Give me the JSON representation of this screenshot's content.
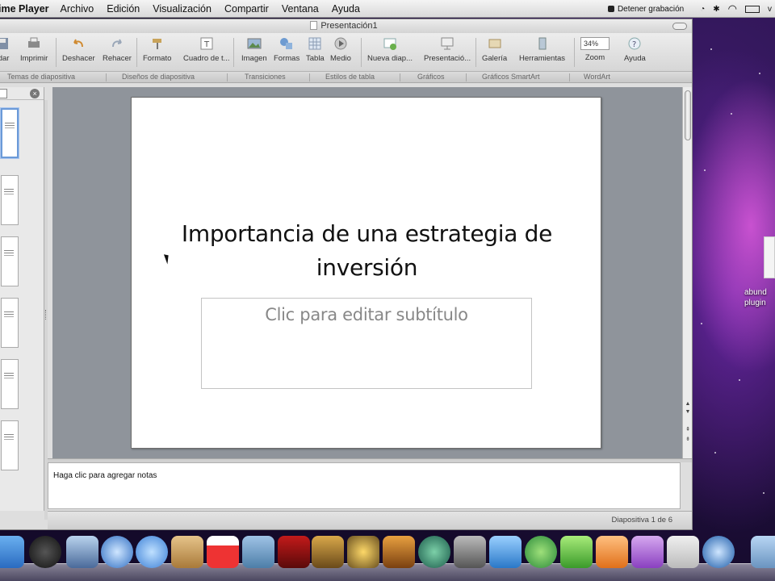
{
  "menubar": {
    "app_name": "ime Player",
    "menus": [
      "Archivo",
      "Edición",
      "Visualización",
      "Compartir",
      "Ventana",
      "Ayuda"
    ],
    "recording_label": "Detener grabación",
    "clock_partial": "v"
  },
  "window": {
    "title": "Presentación1"
  },
  "toolbar": {
    "buttons": [
      "rdar",
      "Imprimir",
      "Deshacer",
      "Rehacer",
      "Formato",
      "Cuadro de t...",
      "Imagen",
      "Formas",
      "Tabla",
      "Medio",
      "Nueva diap...",
      "Presentació...",
      "Galería",
      "Herramientas",
      "Zoom",
      "Ayuda"
    ],
    "zoom_value": "34%"
  },
  "ribbon_tabs": [
    "Temas de diapositiva",
    "Diseños de diapositiva",
    "Transiciones",
    "Estilos de tabla",
    "Gráficos",
    "Gráficos SmartArt",
    "WordArt"
  ],
  "slide": {
    "title_line1": "Importancia de una estrategia de",
    "title_line2": "inversión",
    "subtitle_placeholder": "Clic para editar subtítulo"
  },
  "notes": {
    "placeholder": "Haga clic para agregar notas"
  },
  "status": {
    "slide_counter": "Diapositiva 1 de 6"
  },
  "desktop": {
    "icon_label_line1": "abund",
    "icon_label_line2": "plugin"
  },
  "dock": {
    "icons": [
      "finder-icon",
      "dashboard-icon",
      "mail-icon",
      "safari-icon",
      "ichat-icon",
      "address-book-icon",
      "ical-icon",
      "iphoto-icon",
      "photo-booth-icon",
      "preview-icon",
      "imovie-icon",
      "garageband-icon",
      "time-machine-icon",
      "system-preferences-icon",
      "word-icon",
      "messenger-icon",
      "excel-icon",
      "powerpoint-icon",
      "entourage-icon",
      "documents-icon",
      "quicktime-icon",
      "folder-icon"
    ]
  }
}
